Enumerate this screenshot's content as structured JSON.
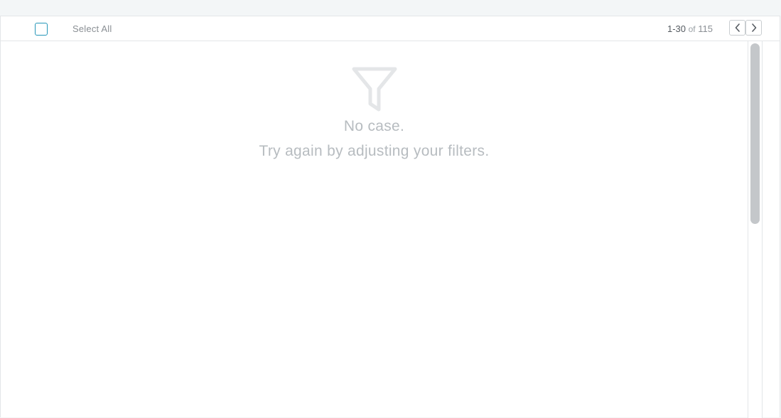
{
  "toolbar": {
    "select_all_label": "Select All",
    "pager": {
      "range": "1-30",
      "of_label": "of",
      "total": "115",
      "prev_icon": "chevron-left-icon",
      "next_icon": "chevron-right-icon"
    }
  },
  "empty_state": {
    "icon": "filter-icon",
    "title": "No case.",
    "subtitle": "Try again by adjusting your filters."
  },
  "colors": {
    "accent": "#2596b8",
    "muted_text": "#b7bcc0",
    "border": "#e3e6e8",
    "scroll_thumb": "#c4c7ca"
  }
}
